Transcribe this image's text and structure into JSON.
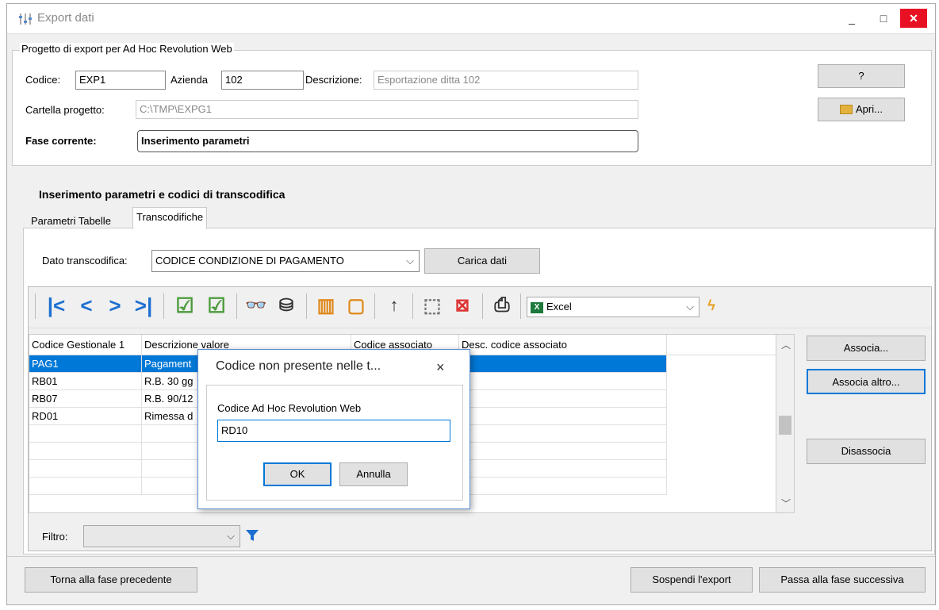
{
  "window": {
    "title": "Export dati",
    "minimize": "_",
    "maximize": "□",
    "close": "✕"
  },
  "project": {
    "group_title": "Progetto di export per Ad Hoc Revolution Web",
    "codice_label": "Codice:",
    "codice_value": "EXP1",
    "azienda_label": "Azienda",
    "azienda_value": "102",
    "descrizione_label": "Descrizione:",
    "descrizione_value": "Esportazione ditta 102",
    "cartella_label": "Cartella progetto:",
    "cartella_value": "C:\\TMP\\EXPG1",
    "fase_label": "Fase corrente:",
    "fase_value": "Inserimento parametri",
    "help_button": "?",
    "apri_button": "Apri..."
  },
  "section_title": "Inserimento parametri e codici di transcodifica",
  "tabs": [
    {
      "label": "Parametri Tabelle"
    },
    {
      "label": "Transcodifiche"
    }
  ],
  "transcodifica": {
    "label": "Dato transcodifica:",
    "value": "CODICE CONDIZIONE DI PAGAMENTO",
    "carica_button": "Carica dati"
  },
  "toolbar": {
    "export_format": "Excel"
  },
  "grid": {
    "columns": [
      "Codice Gestionale 1",
      "Descrizione valore",
      "Codice associato",
      "Desc. codice associato"
    ],
    "rows": [
      {
        "codice": "PAG1",
        "descrizione": "Pagament",
        "associato": "",
        "desc_associato": ""
      },
      {
        "codice": "RB01",
        "descrizione": "R.B. 30 gg",
        "associato": "",
        "desc_associato": ""
      },
      {
        "codice": "RB07",
        "descrizione": "R.B. 90/12",
        "associato": "",
        "desc_associato": ""
      },
      {
        "codice": "RD01",
        "descrizione": "Rimessa d",
        "associato": "",
        "desc_associato": ""
      }
    ]
  },
  "side_buttons": {
    "associa": "Associa...",
    "associa_altro": "Associa altro...",
    "disassocia": "Disassocia"
  },
  "filter": {
    "label": "Filtro:",
    "value": ""
  },
  "dialog": {
    "title": "Codice non presente nelle t...",
    "close": "×",
    "field_label": "Codice Ad Hoc Revolution Web",
    "field_value": "RD10",
    "ok": "OK",
    "annulla": "Annulla"
  },
  "footer": {
    "back_button": "Torna alla fase precedente",
    "suspend_button": "Sospendi l'export",
    "next_button": "Passa alla fase successiva"
  },
  "colors": {
    "accent": "#0078d7",
    "close": "#e81123",
    "nav_arrows": "#1e6fd0"
  }
}
